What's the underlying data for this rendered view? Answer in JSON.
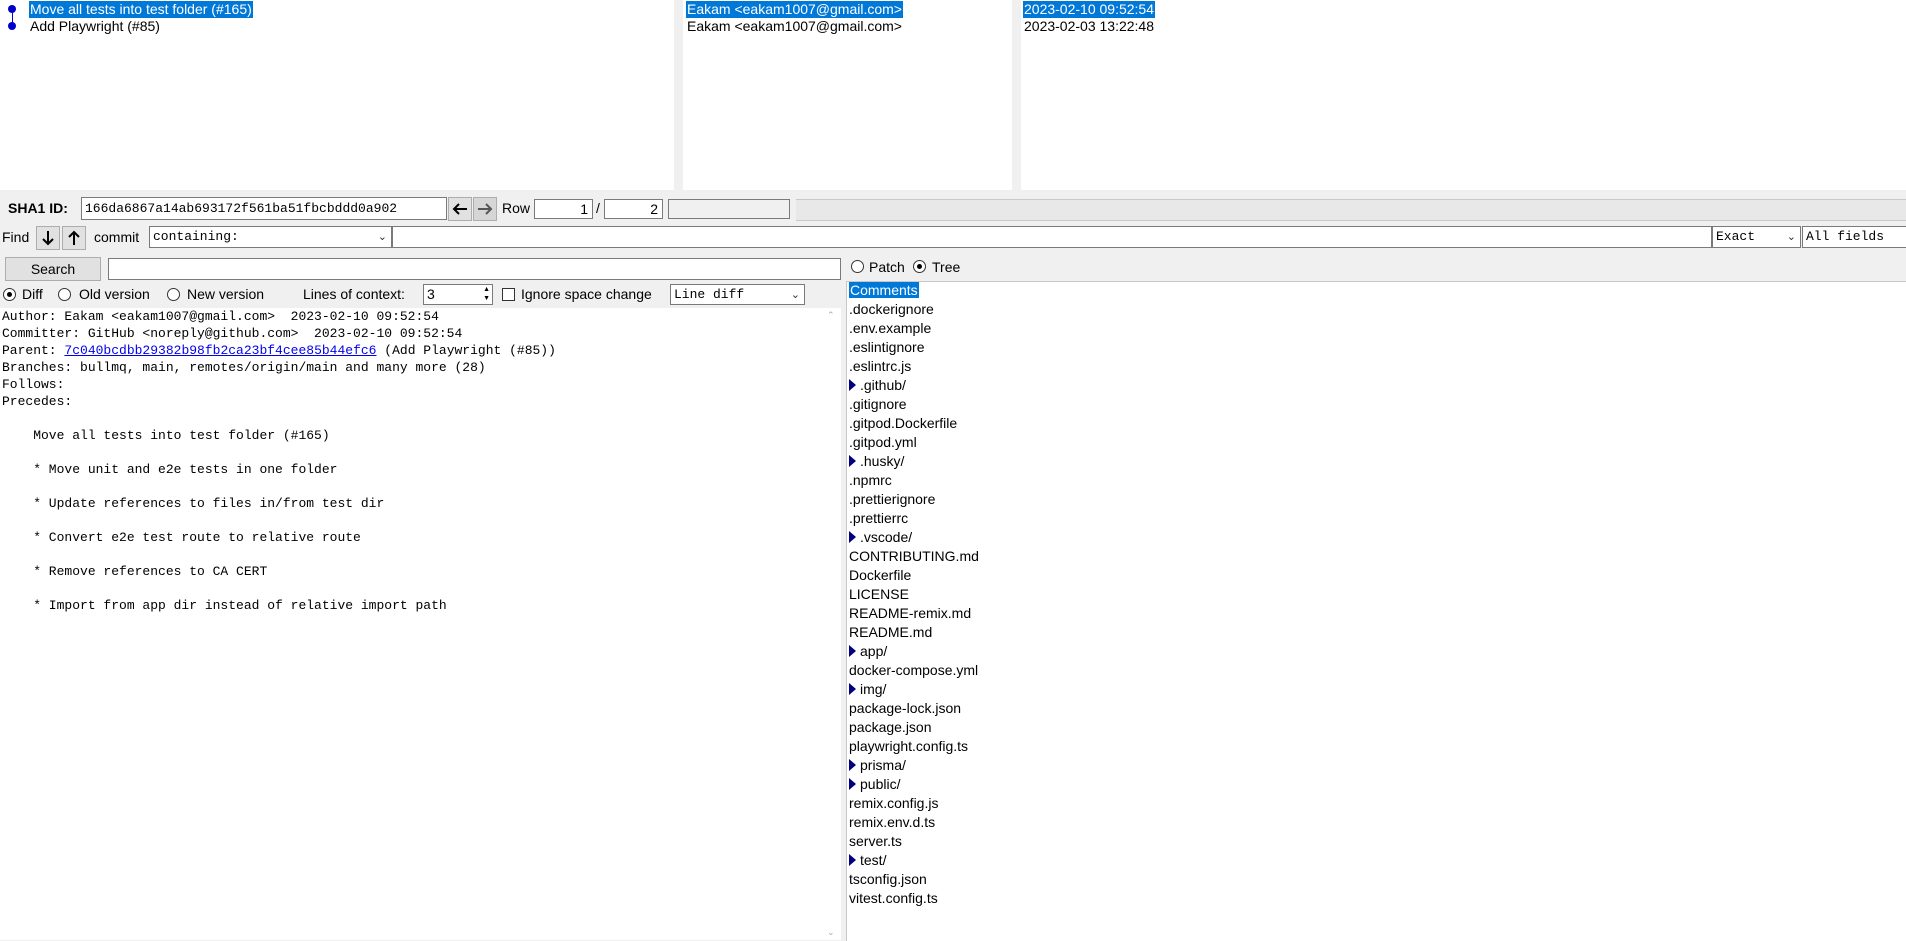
{
  "commits": {
    "rows": [
      {
        "subject": "Move all tests into test folder (#165)",
        "author": "Eakam <eakam1007@gmail.com>",
        "date": "2023-02-10 09:52:54",
        "selected": true
      },
      {
        "subject": "Add Playwright (#85)",
        "author": "Eakam <eakam1007@gmail.com>",
        "date": "2023-02-03 13:22:48",
        "selected": false
      }
    ]
  },
  "toolbar": {
    "sha_label": "SHA1 ID:",
    "sha_value": "166da6867a14ab693172f561ba51fbcbddd0a902",
    "back_icon": "arrow-left-icon",
    "forward_icon": "arrow-right-icon",
    "row_label": "Row",
    "row_current": "1",
    "row_sep": "/",
    "row_total": "2"
  },
  "find": {
    "label": "Find",
    "down_icon": "arrow-down-icon",
    "up_icon": "arrow-up-icon",
    "type_label": "commit",
    "mode_value": "containing:",
    "match_value": "Exact",
    "fields_value": "All fields"
  },
  "search": {
    "button_label": "Search"
  },
  "view_options": {
    "diff": "Diff",
    "old_version": "Old version",
    "new_version": "New version",
    "context_label": "Lines of context:",
    "context_value": "3",
    "ignore_space": "Ignore space change",
    "diff_mode": "Line diff"
  },
  "tree_options": {
    "patch": "Patch",
    "tree": "Tree"
  },
  "details": {
    "author": "Author: Eakam <eakam1007@gmail.com>  2023-02-10 09:52:54",
    "committer": "Committer: GitHub <noreply@github.com>  2023-02-10 09:52:54",
    "parent_prefix": "Parent: ",
    "parent_hash": "7c040bcdbb29382b98fb2ca23bf4cee85b44efc6",
    "parent_suffix": " (Add Playwright (#85))",
    "branches": "Branches: bullmq, main, remotes/origin/main and many more (28)",
    "follows": "Follows:",
    "precedes": "Precedes:",
    "message": [
      "    Move all tests into test folder (#165)",
      "    * Move unit and e2e tests in one folder",
      "    * Update references to files in/from test dir",
      "    * Convert e2e test route to relative route",
      "    * Remove references to CA CERT",
      "    * Import from app dir instead of relative import path"
    ]
  },
  "files": [
    {
      "name": "Comments",
      "dir": false,
      "selected": true
    },
    {
      "name": ".dockerignore",
      "dir": false
    },
    {
      "name": ".env.example",
      "dir": false
    },
    {
      "name": ".eslintignore",
      "dir": false
    },
    {
      "name": ".eslintrc.js",
      "dir": false
    },
    {
      "name": ".github/",
      "dir": true
    },
    {
      "name": ".gitignore",
      "dir": false
    },
    {
      "name": ".gitpod.Dockerfile",
      "dir": false
    },
    {
      "name": ".gitpod.yml",
      "dir": false
    },
    {
      "name": ".husky/",
      "dir": true
    },
    {
      "name": ".npmrc",
      "dir": false
    },
    {
      "name": ".prettierignore",
      "dir": false
    },
    {
      "name": ".prettierrc",
      "dir": false
    },
    {
      "name": ".vscode/",
      "dir": true
    },
    {
      "name": "CONTRIBUTING.md",
      "dir": false
    },
    {
      "name": "Dockerfile",
      "dir": false
    },
    {
      "name": "LICENSE",
      "dir": false
    },
    {
      "name": "README-remix.md",
      "dir": false
    },
    {
      "name": "README.md",
      "dir": false
    },
    {
      "name": "app/",
      "dir": true
    },
    {
      "name": "docker-compose.yml",
      "dir": false
    },
    {
      "name": "img/",
      "dir": true
    },
    {
      "name": "package-lock.json",
      "dir": false
    },
    {
      "name": "package.json",
      "dir": false
    },
    {
      "name": "playwright.config.ts",
      "dir": false
    },
    {
      "name": "prisma/",
      "dir": true
    },
    {
      "name": "public/",
      "dir": true
    },
    {
      "name": "remix.config.js",
      "dir": false
    },
    {
      "name": "remix.env.d.ts",
      "dir": false
    },
    {
      "name": "server.ts",
      "dir": false
    },
    {
      "name": "test/",
      "dir": true
    },
    {
      "name": "tsconfig.json",
      "dir": false
    },
    {
      "name": "vitest.config.ts",
      "dir": false
    }
  ],
  "colors": {
    "selection": "#0078d7",
    "graph": "#0000cc",
    "link": "#0000ee"
  }
}
